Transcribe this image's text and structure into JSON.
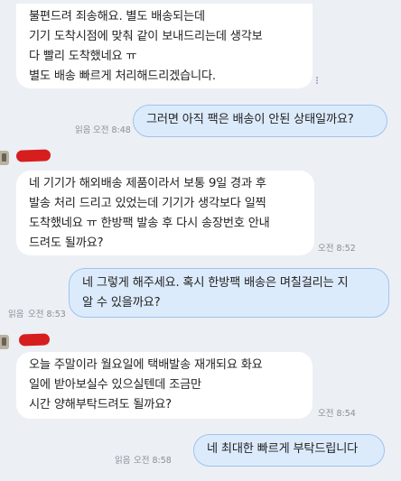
{
  "messages": [
    {
      "text": "불편드려 죄송해요. 별도 배송되는데\n기기 도착시점에 맞춰 같이 보내드리는데 생각보\n다 빨리 도착했네요 ㅠ\n별도 배송 빠르게 처리해드리겠습니다."
    },
    {
      "text": "그러면 아직 팩은 배송이 안된 상태일까요?",
      "read": "읽음",
      "time": "오전 8:48"
    },
    {
      "text": "네 기기가 해외배송 제품이라서 보통 9일 경과 후\n발송 처리 드리고 있었는데 기기가 생각보다 일찍\n도착했네요 ㅠ 한방팩 발송 후 다시 송장번호 안내\n드려도 될까요?",
      "time": "오전 8:52"
    },
    {
      "text": "네 그렇게 해주세요. 혹시 한방팩 배송은 며칠걸리는 지\n알 수 있을까요?",
      "read": "읽음",
      "time": "오전 8:53"
    },
    {
      "text": "오늘 주말이라 월요일에 택배발송 재개되요 화요\n일에 받아보실수 있으실텐데 조금만\n시간 양해부탁드려도 될까요?",
      "time": "오전 8:54"
    },
    {
      "text": "네 최대한 빠르게 부탁드립니다",
      "read": "읽음",
      "time": "오전 8:58"
    }
  ],
  "colors": {
    "background": "#eceff4",
    "incoming_bubble": "#ffffff",
    "outgoing_bubble": "#dcebfc",
    "outgoing_border": "#9ec3ef",
    "redaction": "#d61e1e"
  },
  "icons": [
    "more-vertical-icon",
    "avatar"
  ]
}
